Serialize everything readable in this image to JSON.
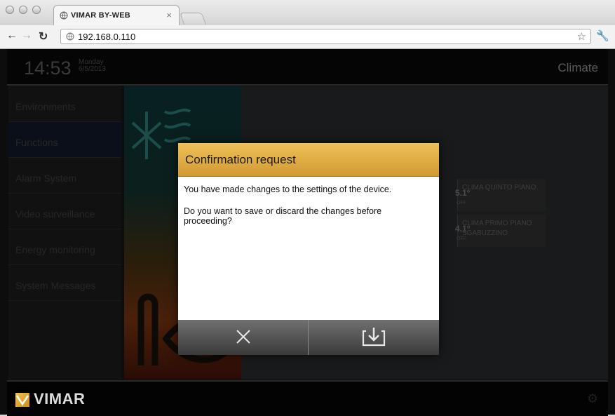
{
  "browser": {
    "tab_title": "VIMAR BY-WEB",
    "tab_close": "×",
    "url": "192.168.0.110"
  },
  "app": {
    "time": "14:53",
    "day": "Monday",
    "date": "6/5/2013",
    "section_title": "Climate"
  },
  "sidebar": {
    "items": [
      {
        "label": "Environments"
      },
      {
        "label": "Functions"
      },
      {
        "label": "Alarm System"
      },
      {
        "label": "Video surveillance"
      },
      {
        "label": "Energy monitoring"
      },
      {
        "label": "System Messages"
      }
    ]
  },
  "devices": [
    {
      "temp": "5.1°",
      "state": "OFF",
      "name": "CLIMA QUINTO PIANO"
    },
    {
      "temp": "4.1°",
      "state": "OFF",
      "name": "CLIMA PRIMO PIANO SGABUZZINO"
    }
  ],
  "modal": {
    "title": "Confirmation request",
    "message_1": "You have made changes to the settings of the device.",
    "message_2": "Do you want to save or discard the changes before proceeding?"
  },
  "footer": {
    "brand": "VIMAR"
  },
  "colors": {
    "modal_header": "#e2ad45",
    "background": "#0d0d0d"
  }
}
